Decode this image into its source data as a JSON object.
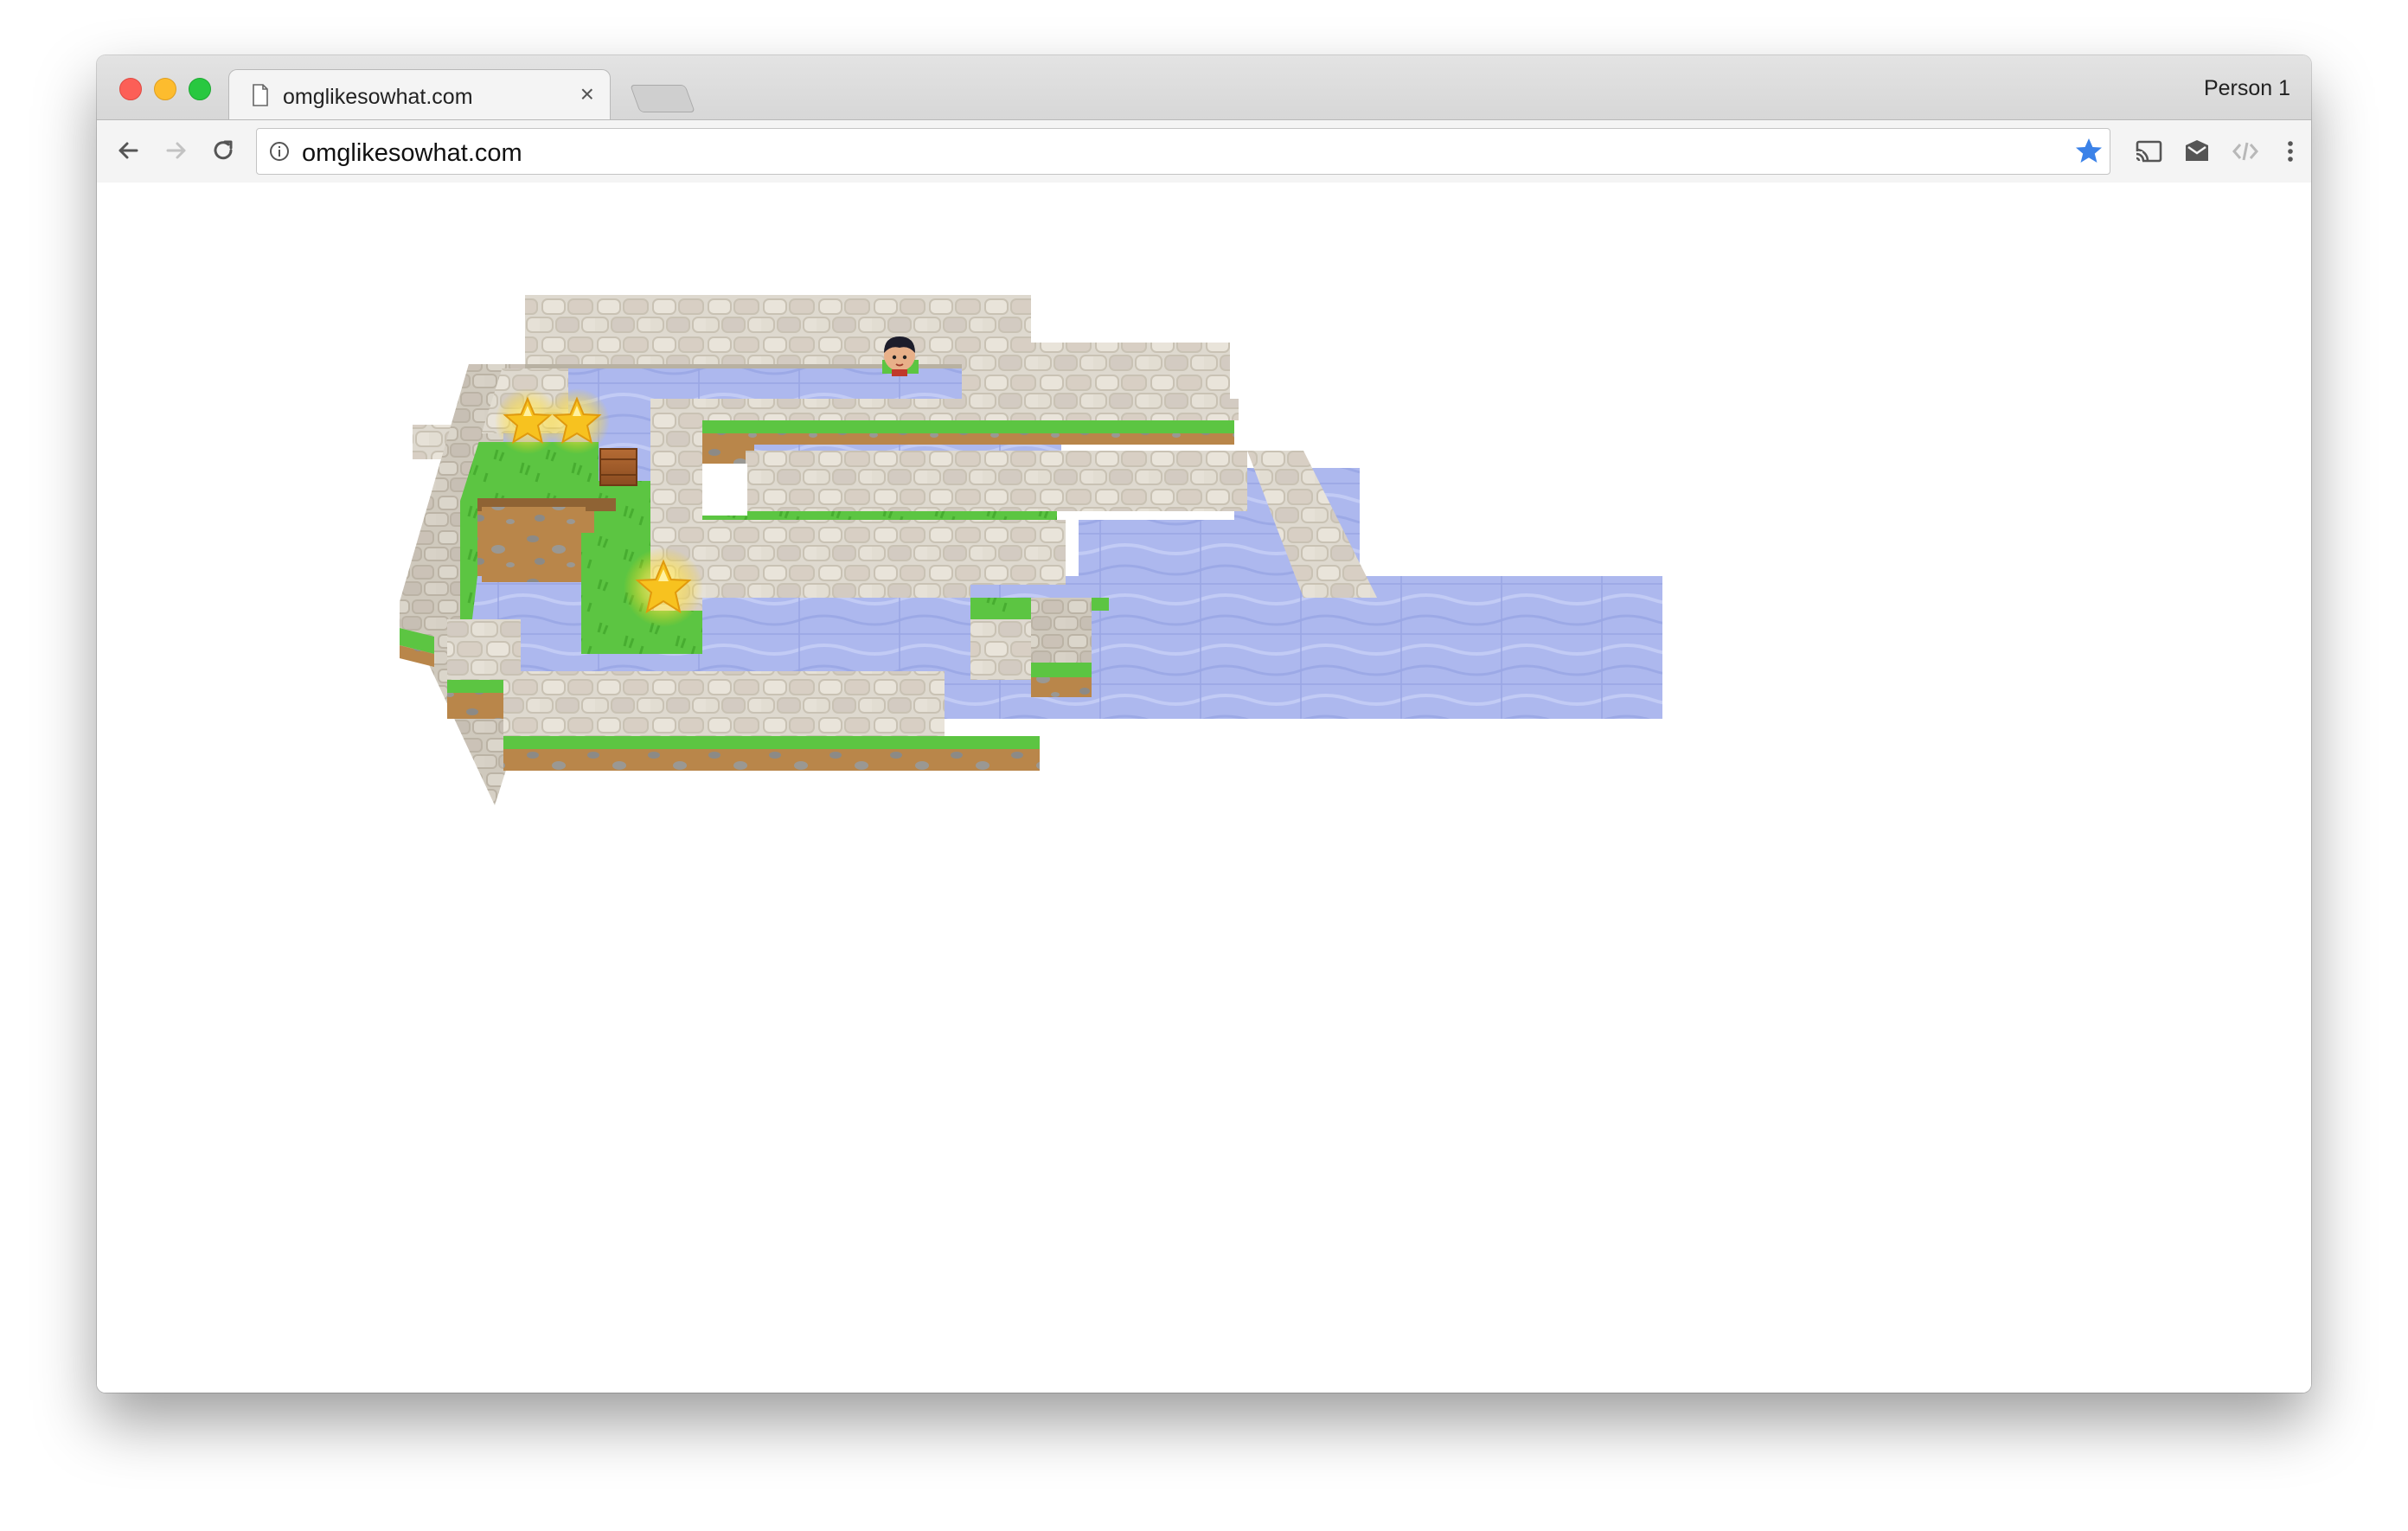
{
  "browser": {
    "tab_title": "omglikesowhat.com",
    "tab_close_glyph": "×",
    "profile_name": "Person 1",
    "url": "omglikesowhat.com",
    "icons": {
      "back": "back-arrow-icon",
      "forward": "forward-arrow-icon",
      "reload": "reload-icon",
      "info": "info-icon",
      "bookmark": "bookmark-star-icon",
      "cast": "cast-icon",
      "ext1": "envelope-extension-icon",
      "ext2": "code-extension-icon",
      "menu": "kebab-menu-icon"
    },
    "colors": {
      "bookmark_star": "#3b82e8",
      "tabstrip": "#dcdcdc",
      "toolbar": "#f4f4f4"
    }
  },
  "game": {
    "collectibles": "star",
    "tiles": [
      "cobblestone-wall",
      "water",
      "grass",
      "dirt"
    ],
    "objects": [
      "player-character",
      "wooden-crate",
      "star",
      "star",
      "star"
    ],
    "colors": {
      "stone": "#d9d4c9",
      "water": "#aeb9ee",
      "grass": "#59c43f",
      "dirt": "#b88548"
    }
  }
}
